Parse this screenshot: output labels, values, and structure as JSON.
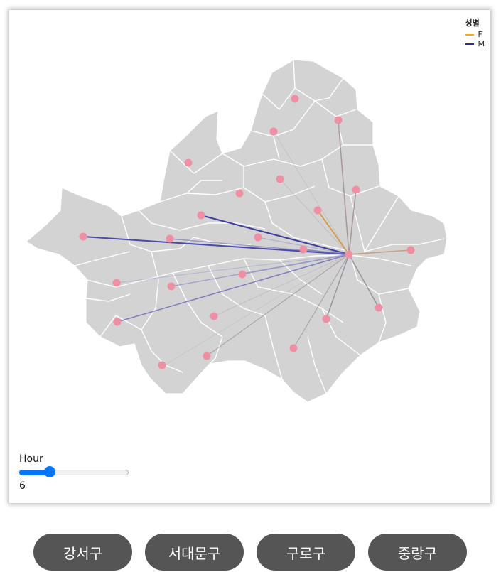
{
  "legend": {
    "title": "성별",
    "items": [
      {
        "label": "F",
        "color": "#f5a623"
      },
      {
        "label": "M",
        "color": "#2a2aa0"
      }
    ]
  },
  "slider": {
    "label": "Hour",
    "value": "6",
    "min": 0,
    "max": 23,
    "current": 6
  },
  "buttons": [
    "강서구",
    "서대문구",
    "구로구",
    "중랑구"
  ],
  "colors": {
    "map_fill": "#d3d3d3",
    "map_stroke": "#ffffff",
    "point": "#ef8fa3",
    "accent": "#0075ff",
    "button_bg": "#555555"
  }
}
